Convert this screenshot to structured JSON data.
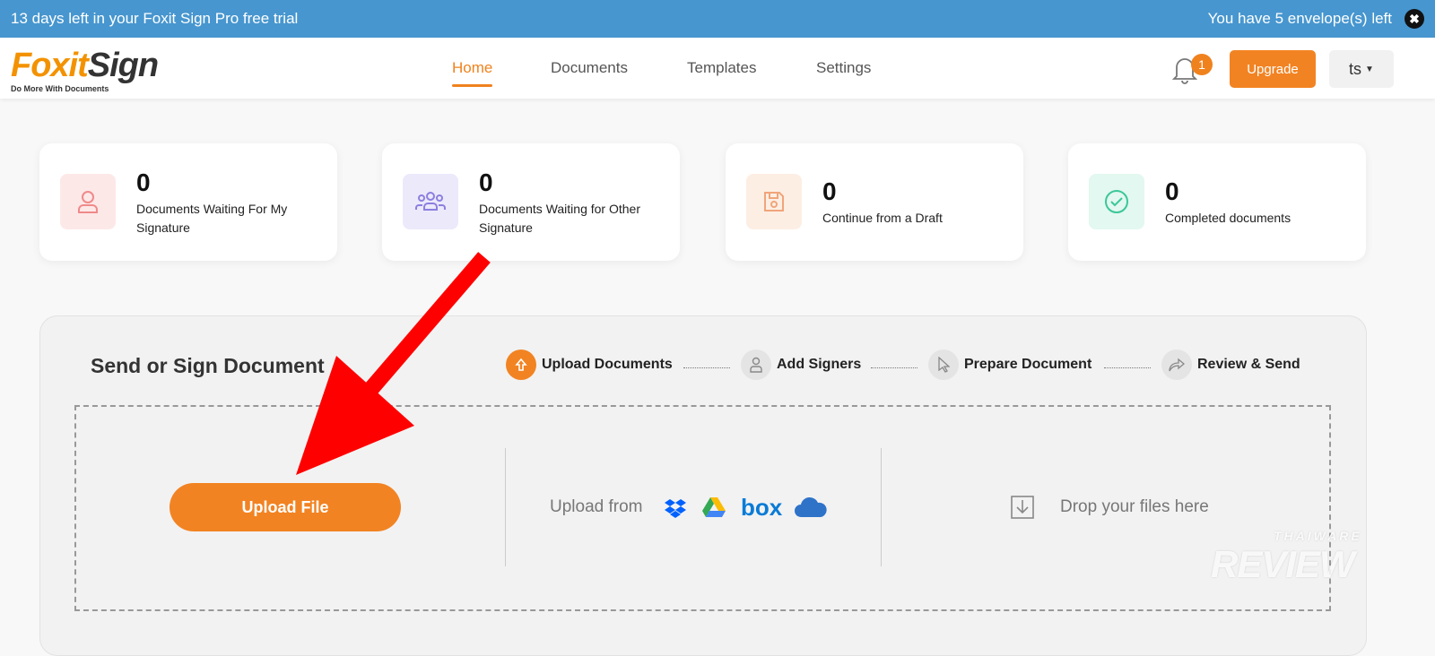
{
  "banner": {
    "trial": "13 days left in your Foxit Sign Pro free trial",
    "envelopes": "You have 5 envelope(s) left",
    "close": "✖"
  },
  "logo": {
    "part1": "Foxit",
    "part2": "Sign",
    "tagline": "Do More With Documents"
  },
  "nav": [
    "Home",
    "Documents",
    "Templates",
    "Settings"
  ],
  "notifications": {
    "count": "1"
  },
  "upgrade": "Upgrade",
  "user": "ts",
  "stats": [
    {
      "count": "0",
      "label": "Documents Waiting For My Signature",
      "color": "#f08a8a",
      "bg": "#fde8e8"
    },
    {
      "count": "0",
      "label": "Documents Waiting for Other Signature",
      "color": "#8b7fe0",
      "bg": "#ece9fb"
    },
    {
      "count": "0",
      "label": "Continue from a Draft",
      "color": "#f0a57a",
      "bg": "#fdeee4"
    },
    {
      "count": "0",
      "label": "Completed documents",
      "color": "#3cc79a",
      "bg": "#e2f8f0"
    }
  ],
  "send": {
    "title": "Send or Sign Document",
    "steps": [
      "Upload Documents",
      "Add Signers",
      "Prepare Document",
      "Review & Send"
    ],
    "upload_button": "Upload File",
    "upload_from": "Upload from",
    "cloud": {
      "box": "box"
    },
    "drop": "Drop your files here"
  },
  "watermark": "THAIWARE REVIEW"
}
